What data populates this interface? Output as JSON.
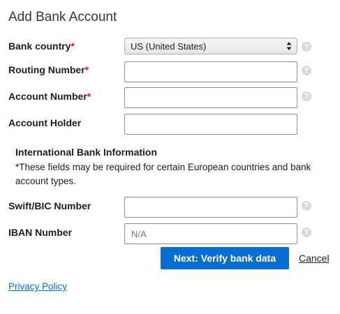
{
  "page": {
    "title": "Add Bank Account"
  },
  "fields": {
    "bank_country": {
      "label": "Bank country",
      "required_mark": "*",
      "value": "US (United States)"
    },
    "routing_number": {
      "label": "Routing Number",
      "required_mark": "*",
      "value": ""
    },
    "account_number": {
      "label": "Account Number",
      "required_mark": "*",
      "value": ""
    },
    "account_holder": {
      "label": "Account Holder",
      "value": ""
    },
    "swift_bic": {
      "label": "Swift/BIC Number",
      "value": ""
    },
    "iban": {
      "label": "IBAN Number",
      "value": "",
      "placeholder": "N/A"
    }
  },
  "international": {
    "heading": "International Bank Information",
    "note": "*These fields may be required for certain European countries and bank account types."
  },
  "help_icon_glyph": "?",
  "actions": {
    "next_label": "Next: Verify bank data",
    "cancel_label": "Cancel"
  },
  "footer": {
    "privacy_label": "Privacy Policy"
  },
  "colors": {
    "primary": "#0a6ed1",
    "required": "#e0142a",
    "help_icon": "#d9d9d9"
  }
}
